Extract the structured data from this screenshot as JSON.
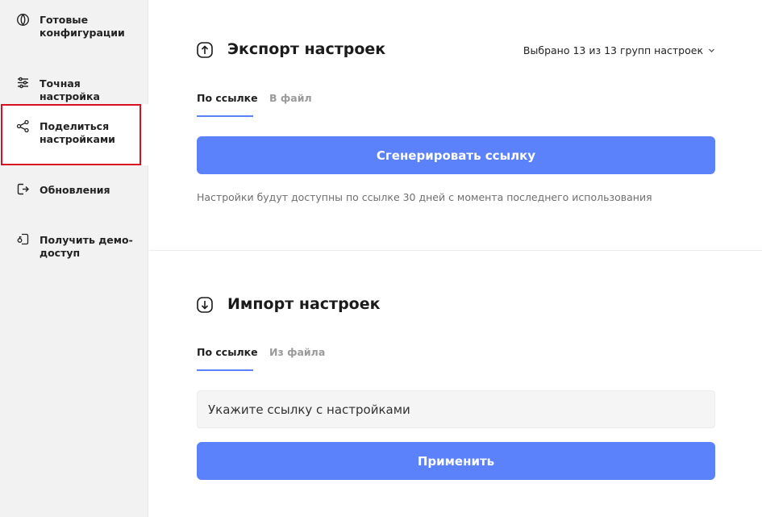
{
  "sidebar": {
    "items": [
      {
        "label": "Готовые конфигурации",
        "icon": "configurations-icon"
      },
      {
        "label": "Точная настройка",
        "icon": "sliders-icon"
      },
      {
        "label": "Поделиться настройками",
        "icon": "share-icon"
      },
      {
        "label": "Обновления",
        "icon": "update-icon"
      },
      {
        "label": "Получить демо-доступ",
        "icon": "demo-access-icon"
      }
    ],
    "active_index": 2
  },
  "export": {
    "title": "Экспорт настроек",
    "icon": "upload-arrow-icon",
    "selector": "Выбрано 13 из 13 групп настроек",
    "tabs": [
      "По ссылке",
      "В файл"
    ],
    "active_tab": 0,
    "button": "Сгенерировать ссылку",
    "hint": "Настройки будут доступны по ссылке 30 дней с момента последнего использования"
  },
  "import": {
    "title": "Импорт настроек",
    "icon": "download-arrow-icon",
    "tabs": [
      "По ссылке",
      "Из файла"
    ],
    "active_tab": 0,
    "input_placeholder": "Укажите ссылку с настройками",
    "button": "Применить"
  },
  "colors": {
    "accent": "#5b82fb",
    "highlight": "#d8101f",
    "sidebar_bg": "#f2f2f2"
  }
}
